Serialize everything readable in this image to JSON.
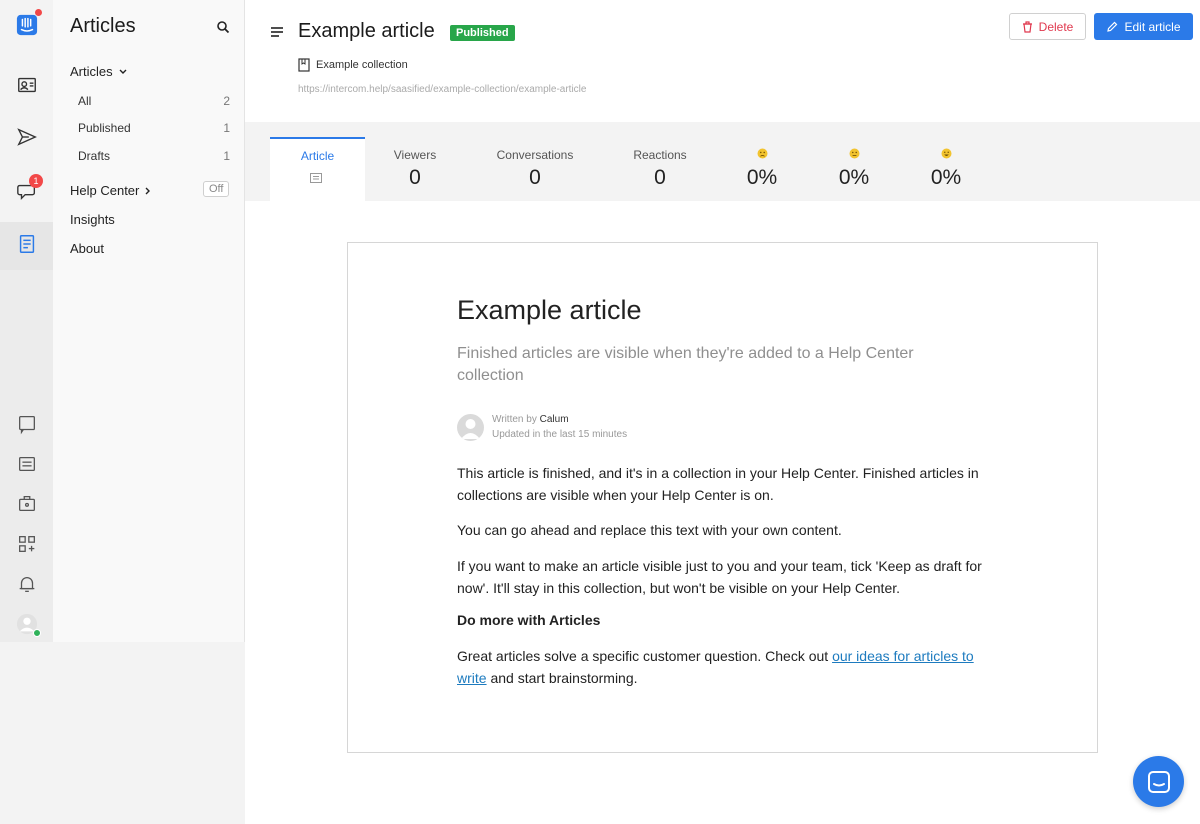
{
  "sidebar": {
    "title": "Articles",
    "articles_label": "Articles",
    "items": [
      {
        "label": "All",
        "count": "2"
      },
      {
        "label": "Published",
        "count": "1"
      },
      {
        "label": "Drafts",
        "count": "1"
      }
    ],
    "help_center_label": "Help Center",
    "help_center_status": "Off",
    "insights_label": "Insights",
    "about_label": "About"
  },
  "rail": {
    "conversations_badge": "1"
  },
  "header": {
    "title": "Example article",
    "status_badge": "Published",
    "collection": "Example collection",
    "url": "https://intercom.help/saasified/example-collection/example-article",
    "delete_label": "Delete",
    "edit_label": "Edit article"
  },
  "stats": {
    "article_tab": "Article",
    "viewers_label": "Viewers",
    "viewers_value": "0",
    "conversations_label": "Conversations",
    "conversations_value": "0",
    "reactions_label": "Reactions",
    "reactions_value": "0",
    "sad_value": "0%",
    "neutral_value": "0%",
    "happy_value": "0%"
  },
  "article": {
    "title": "Example article",
    "subtitle": "Finished articles are visible when they're added to a Help Center collection",
    "written_by": "Written by",
    "author": "Calum",
    "updated": "Updated in the last 15 minutes",
    "p1": "This article is finished, and it's in a collection in your Help Center. Finished articles in collections are visible when your Help Center is on.",
    "p2": "You can go ahead and replace this text with your own content.",
    "p3": "If you want to make an article visible just to you and your team, tick 'Keep as draft for now'. It'll stay in this collection, but won't be visible on your Help Center.",
    "heading": "Do more with Articles",
    "p4_before": "Great articles solve a specific customer question. Check out ",
    "p4_link": "our ideas for articles to write",
    "p4_after": " and start brainstorming."
  },
  "colors": {
    "accent": "#2b7ae8",
    "published": "#28a64a",
    "danger": "#e0384e"
  }
}
